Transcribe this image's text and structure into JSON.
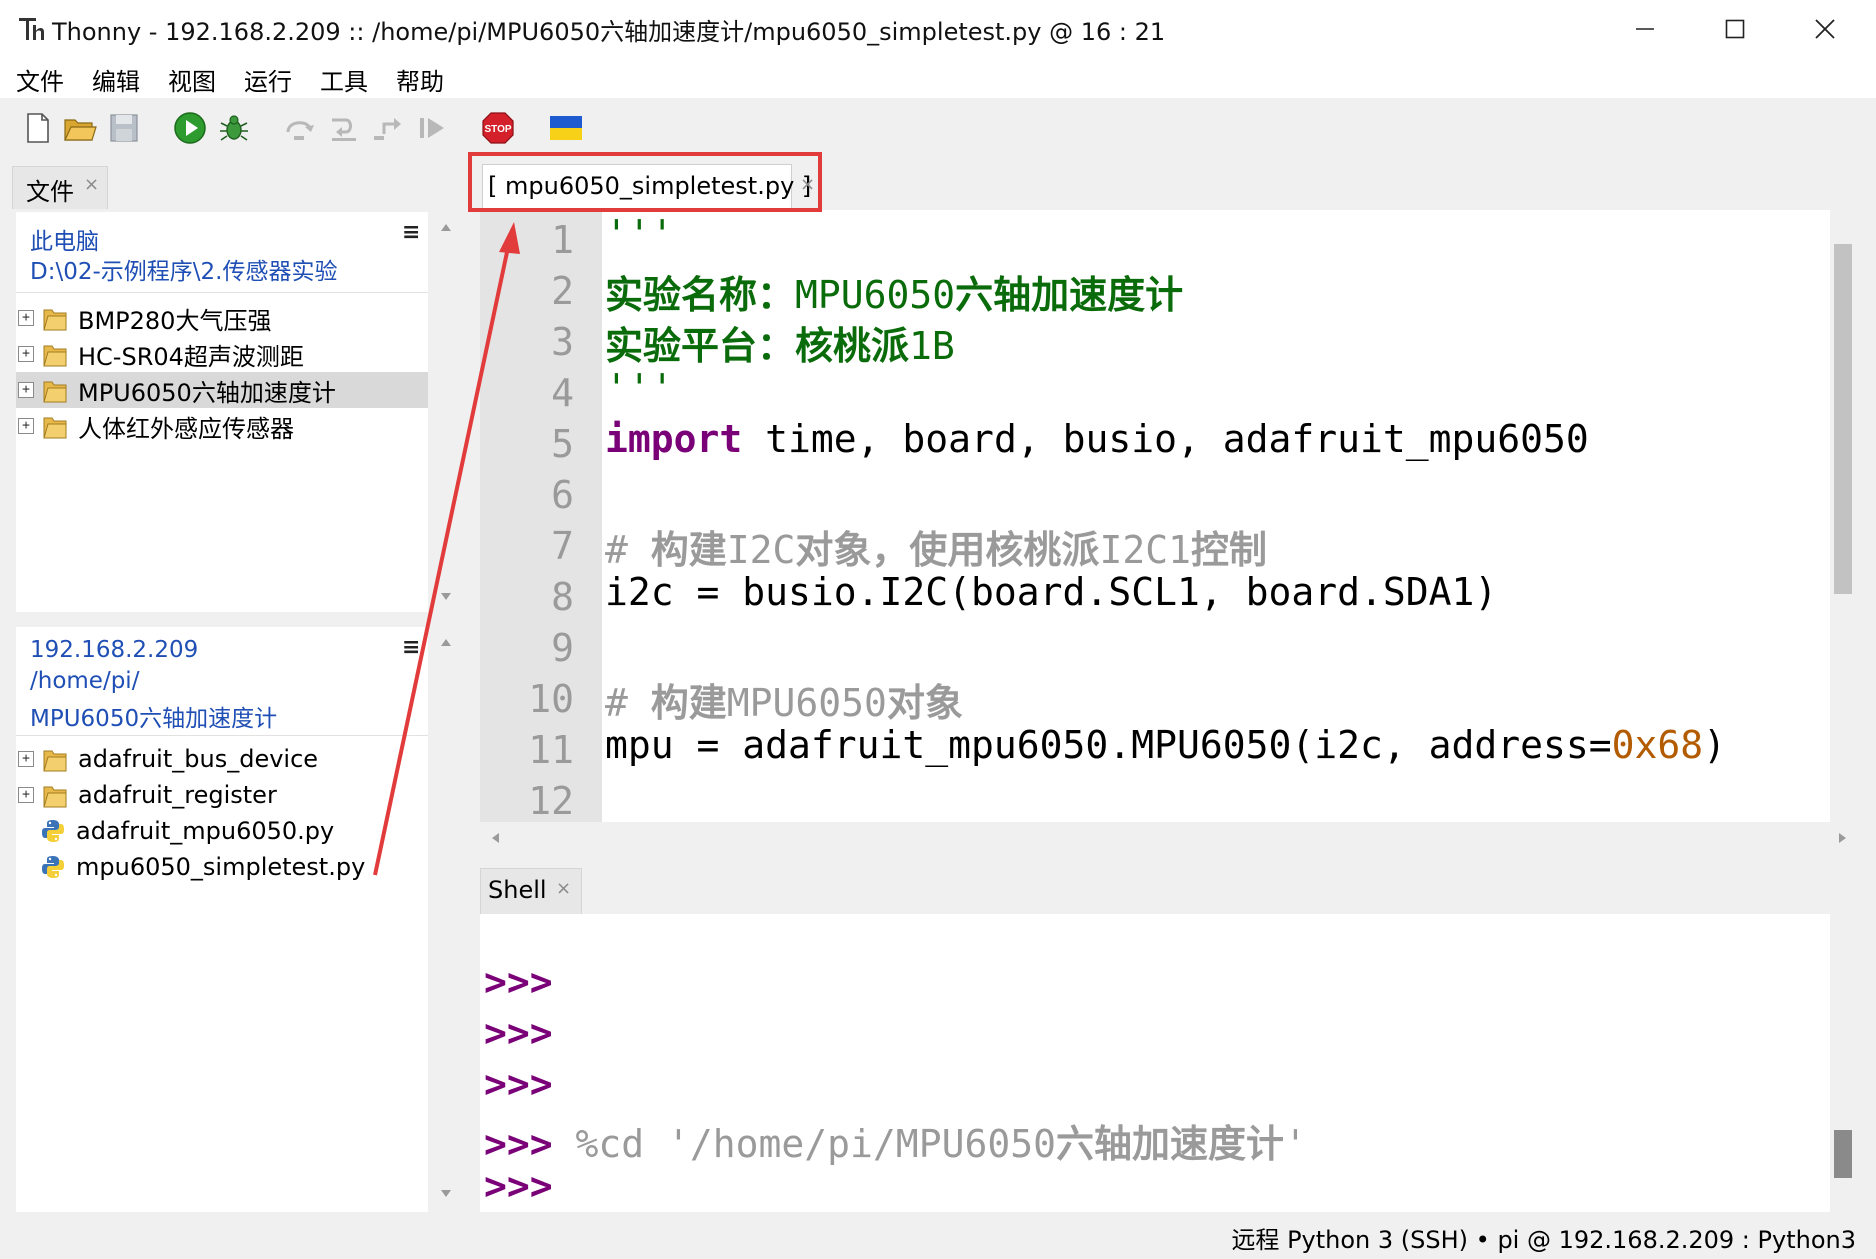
{
  "window": {
    "title": "Thonny  -  192.168.2.209 :: /home/pi/MPU6050六轴加速度计/mpu6050_simpletest.py  @  16 : 21",
    "minimize_glyph": "—",
    "maximize_glyph": "☐",
    "close_glyph": "✕"
  },
  "menu": [
    "文件",
    "编辑",
    "视图",
    "运行",
    "工具",
    "帮助"
  ],
  "toolbar": {
    "icons": [
      "new-file-icon",
      "open-file-icon",
      "save-icon",
      "run-icon",
      "debug-icon",
      "step-over-icon",
      "step-into-icon",
      "step-out-icon",
      "resume-icon",
      "stop-icon",
      "ukraine-flag-icon"
    ],
    "stop_label": "STOP"
  },
  "files_panel": {
    "tab_label": "文件",
    "tab_close": "×",
    "menu_glyph": "≡",
    "local": {
      "path_line1": "此电脑",
      "path_line2": "D:\\02-示例程序\\2.传感器实验",
      "items": [
        "BMP280大气压强",
        "HC-SR04超声波测距",
        "MPU6050六轴加速度计",
        "人体红外感应传感器"
      ],
      "selected_index": 2
    },
    "remote": {
      "path_line1": "192.168.2.209",
      "path_line2": "/home/pi/",
      "path_line3": "MPU6050六轴加速度计",
      "folders": [
        "adafruit_bus_device",
        "adafruit_register"
      ],
      "files": [
        "adafruit_mpu6050.py",
        "mpu6050_simpletest.py"
      ]
    }
  },
  "editor": {
    "tab_label": "[ mpu6050_simpletest.py ]",
    "tab_close": "×",
    "line_numbers": [
      "1",
      "2",
      "3",
      "4",
      "5",
      "6",
      "7",
      "8",
      "9",
      "10",
      "11",
      "12"
    ],
    "lines": {
      "l1": "'''",
      "l2_label": "实验名称：",
      "l2_value_a": "MPU6050",
      "l2_value_b": "六轴加速度计",
      "l3_label": "实验平台：",
      "l3_value_a": "核桃派",
      "l3_value_b": "1B",
      "l4": "'''",
      "l5_kw": "import",
      "l5_rest": " time, board, busio, adafruit_mpu6050",
      "l7_hash": "# ",
      "l7_a": "构建",
      "l7_b": "I2C",
      "l7_c": "对象，使用核桃派",
      "l7_d": "I2C1",
      "l7_e": "控制",
      "l8": "i2c = busio.I2C(board.SCL1, board.SDA1)",
      "l10_hash": "# ",
      "l10_a": "构建",
      "l10_b": "MPU6050",
      "l10_c": "对象",
      "l11_a": "mpu = adafruit_mpu6050.MPU6050(i2c, address=",
      "l11_num": "0x68",
      "l11_b": ")"
    }
  },
  "shell": {
    "tab_label": "Shell",
    "tab_close": "×",
    "prompt": ">>>",
    "cmd_a": " %cd '/home/pi/MPU6050",
    "cmd_b": "六轴加速度计",
    "cmd_c": "'"
  },
  "status": {
    "text": "远程 Python 3 (SSH)  •  pi @ 192.168.2.209 : Python3"
  },
  "colors": {
    "highlight_box": "#e23b3b",
    "keyword": "#7a0078",
    "docstring": "#0a6b0a",
    "comment": "#9a9a9a",
    "number": "#b35b00",
    "link": "#1f4fb5"
  }
}
